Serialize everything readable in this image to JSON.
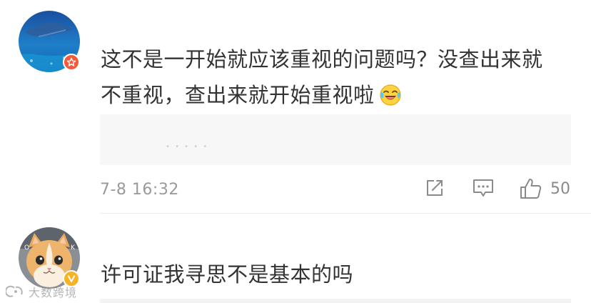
{
  "comments": [
    {
      "text_line1": "这不是一开始就应该重视的问题吗？没查出来就",
      "text_line2": "不重视，查出来就开始重视啦",
      "emoji": "laughing-crying-emoji",
      "time": "7-8 16:32",
      "like_count": "50",
      "badge": "star-badge"
    },
    {
      "text": "许可证我寻思不是基本的吗",
      "badge": "verified-v-badge"
    }
  ],
  "watermark": {
    "text": "大数跨境"
  },
  "colors": {
    "text": "#333333",
    "meta": "#9a9a9a",
    "icon": "#8a8a8a",
    "star_badge": "#f25a3b",
    "v_badge": "#f5b325",
    "card_bg": "#f7f7f7"
  }
}
